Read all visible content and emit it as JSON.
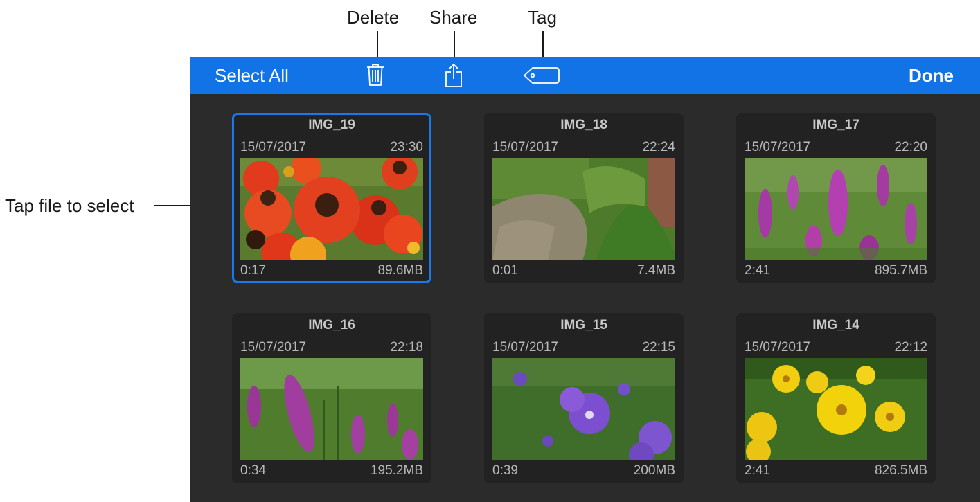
{
  "callouts": {
    "delete": "Delete",
    "share": "Share",
    "tag": "Tag",
    "tap_file": "Tap file to select"
  },
  "toolbar": {
    "select_all_label": "Select All",
    "done_label": "Done",
    "icons": [
      "trash-icon",
      "share-icon",
      "tag-icon"
    ],
    "accent": "#1273e6"
  },
  "files": [
    {
      "name": "IMG_19",
      "date": "15/07/2017",
      "time": "23:30",
      "duration": "0:17",
      "size": "89.6MB",
      "selected": true,
      "thumbnail": "red-orange flowers"
    },
    {
      "name": "IMG_18",
      "date": "15/07/2017",
      "time": "22:24",
      "duration": "0:01",
      "size": "7.4MB",
      "selected": false,
      "thumbnail": "gravel path and grass"
    },
    {
      "name": "IMG_17",
      "date": "15/07/2017",
      "time": "22:20",
      "duration": "2:41",
      "size": "895.7MB",
      "selected": false,
      "thumbnail": "purple flower spikes"
    },
    {
      "name": "IMG_16",
      "date": "15/07/2017",
      "time": "22:18",
      "duration": "0:34",
      "size": "195.2MB",
      "selected": false,
      "thumbnail": "purple flower spike close-up"
    },
    {
      "name": "IMG_15",
      "date": "15/07/2017",
      "time": "22:15",
      "duration": "0:39",
      "size": "200MB",
      "selected": false,
      "thumbnail": "violet bellflowers"
    },
    {
      "name": "IMG_14",
      "date": "15/07/2017",
      "time": "22:12",
      "duration": "2:41",
      "size": "826.5MB",
      "selected": false,
      "thumbnail": "yellow flowers"
    }
  ]
}
